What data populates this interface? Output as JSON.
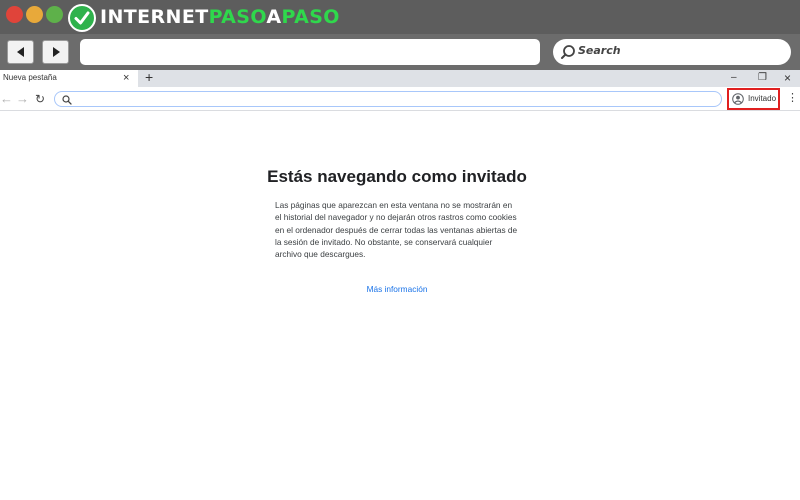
{
  "brand": {
    "part1": "INTERNET",
    "part2": "PASO",
    "part3": "A",
    "part4": "PASO"
  },
  "outer_browser": {
    "search_placeholder": "Search"
  },
  "tab": {
    "title": "Nueva pestaña",
    "close_glyph": "×",
    "new_tab_glyph": "+"
  },
  "window_controls": {
    "minimize": "–",
    "maximize": "❐",
    "close": "×"
  },
  "toolbar": {
    "back_glyph": "←",
    "forward_glyph": "→",
    "reload_glyph": "↻",
    "profile_label": "Invitado",
    "menu_glyph": "⋮"
  },
  "icons": {
    "search": "search-icon",
    "profile": "guest-avatar-icon"
  },
  "page": {
    "title": "Estás navegando como invitado",
    "body": "Las páginas que aparezcan en esta ventana no se mostrarán en el historial del navegador y no dejarán otros rastros como cookies en el ordenador después de cerrar todas las ventanas abiertas de la sesión de invitado. No obstante, se conservará cualquier archivo que descargues.",
    "link": "Más información"
  },
  "colors": {
    "highlight": "#e02020",
    "link": "#1a73e8",
    "brand_green": "#2fd84c"
  }
}
